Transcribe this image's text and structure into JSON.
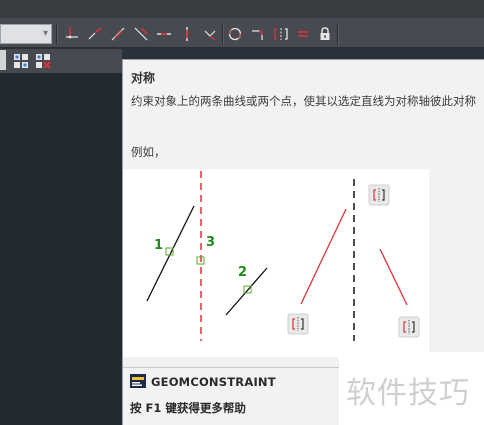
{
  "toolbar": {
    "constraint_tools": [
      {
        "icon": "coincident-icon"
      },
      {
        "icon": "collinear-icon"
      },
      {
        "icon": "concentric-icon"
      },
      {
        "icon": "fix-icon"
      },
      {
        "icon": "parallel-icon"
      },
      {
        "icon": "perpendicular-icon"
      },
      {
        "icon": "horizontal-icon"
      },
      {
        "icon": "vertical-icon"
      },
      {
        "icon": "tangent-icon"
      },
      {
        "icon": "smooth-icon"
      },
      {
        "icon": "symmetric-icon"
      },
      {
        "icon": "equal-icon"
      },
      {
        "icon": "lock-icon"
      }
    ],
    "row2_tools": [
      {
        "icon": "grid-icon"
      },
      {
        "icon": "grid-delete-icon"
      }
    ]
  },
  "tooltip": {
    "title": "对称",
    "description": "约束对象上的两条曲线或两个点，使其以选定直线为对称轴彼此对称",
    "example_label": "例如，",
    "figure_labels": [
      "1",
      "3",
      "2"
    ],
    "command_name": "GEOMCONSTRAINT",
    "help_text": "按 F1 键获得更多帮助"
  },
  "watermark": "软件技巧",
  "colors": {
    "constraint_red": "#d9343a",
    "label_green": "#1f8a1f",
    "grip_green": "#5aa832"
  }
}
